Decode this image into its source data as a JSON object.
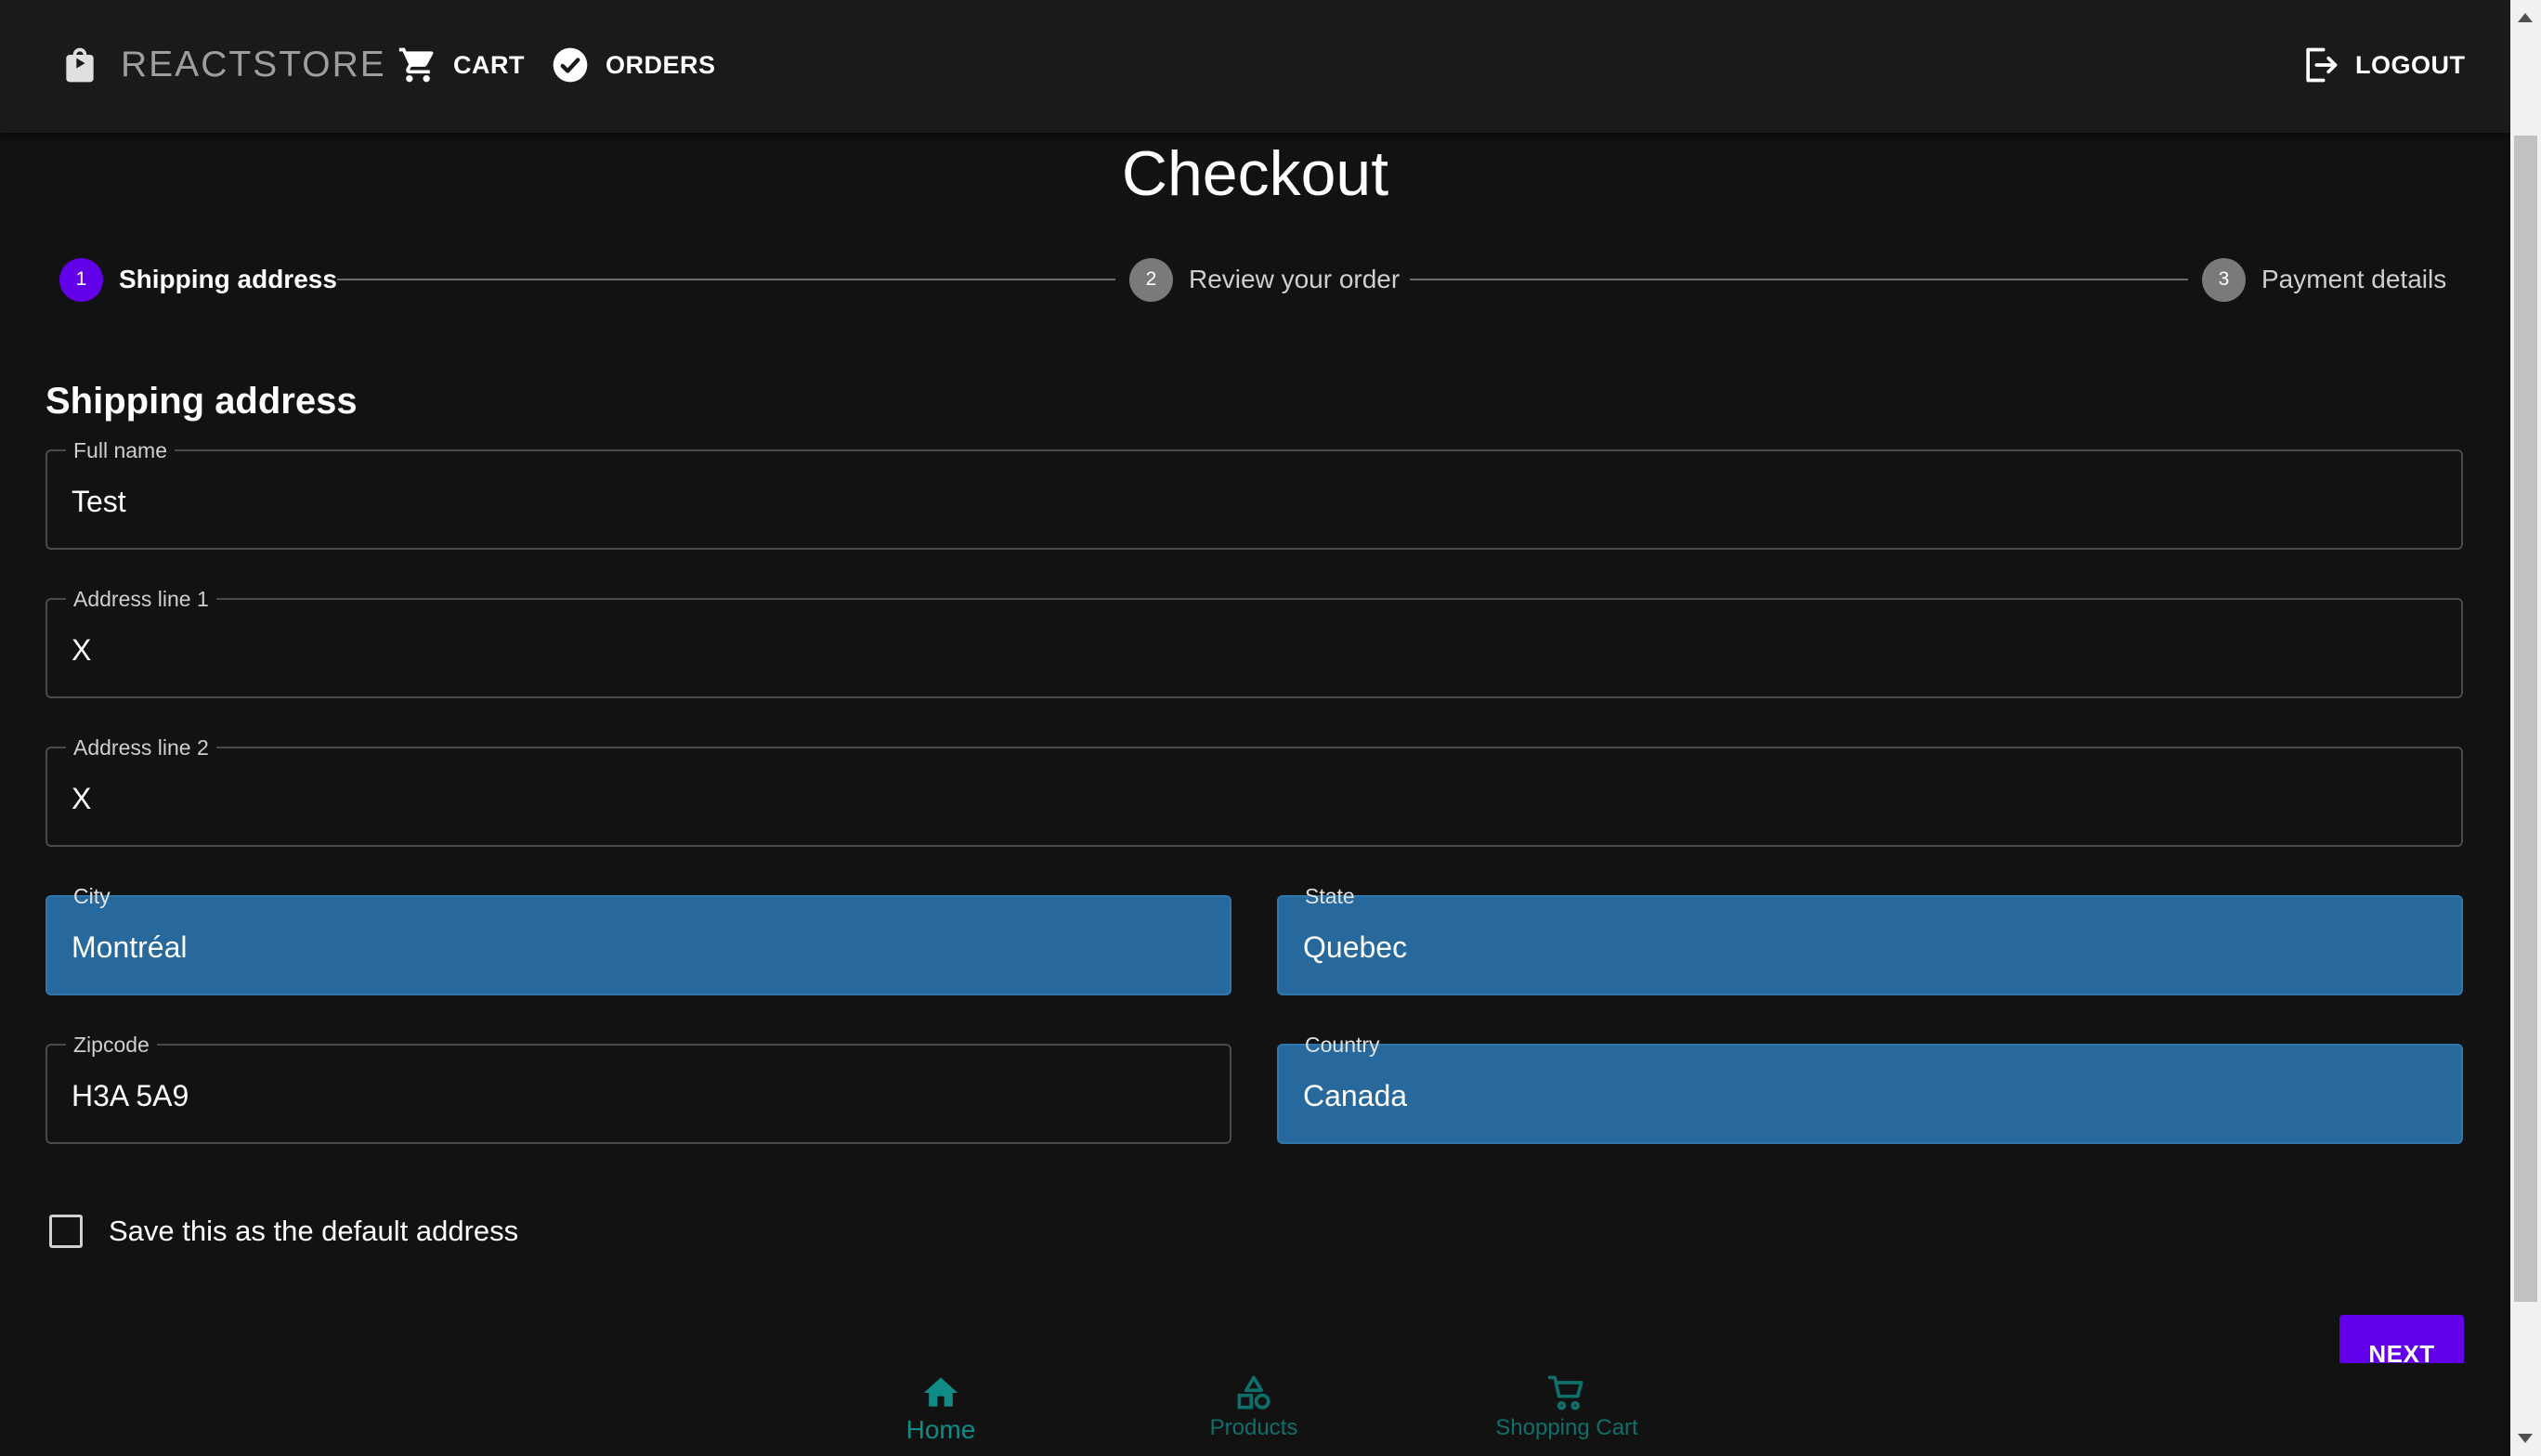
{
  "header": {
    "brand": "REACTSTORE",
    "nav": {
      "cart": "CART",
      "orders": "ORDERS",
      "logout": "LOGOUT"
    }
  },
  "page": {
    "title": "Checkout"
  },
  "stepper": {
    "steps": [
      {
        "number": "1",
        "label": "Shipping address",
        "state": "active"
      },
      {
        "number": "2",
        "label": "Review your order",
        "state": "inactive"
      },
      {
        "number": "3",
        "label": "Payment details",
        "state": "inactive"
      }
    ]
  },
  "form": {
    "section_title": "Shipping address",
    "fields": {
      "full_name": {
        "label": "Full name",
        "value": "Test"
      },
      "address1": {
        "label": "Address line 1",
        "value": "X"
      },
      "address2": {
        "label": "Address line 2",
        "value": "X"
      },
      "city": {
        "label": "City",
        "value": "Montréal"
      },
      "state": {
        "label": "State",
        "value": "Quebec"
      },
      "zipcode": {
        "label": "Zipcode",
        "value": "H3A 5A9"
      },
      "country": {
        "label": "Country",
        "value": "Canada"
      }
    },
    "default_checkbox": {
      "label": "Save this as the default address",
      "checked": false
    },
    "next_label": "NEXT"
  },
  "bottom_nav": {
    "items": [
      {
        "label": "Home",
        "icon": "home-icon",
        "active": true
      },
      {
        "label": "Products",
        "icon": "shapes-icon",
        "active": false
      },
      {
        "label": "Shopping Cart",
        "icon": "cart-outline-icon",
        "active": false
      }
    ]
  },
  "colors": {
    "primary": "#6200ea",
    "autofill": "#27699c",
    "bottom_nav": "#0f6f6b",
    "background": "#121212"
  }
}
